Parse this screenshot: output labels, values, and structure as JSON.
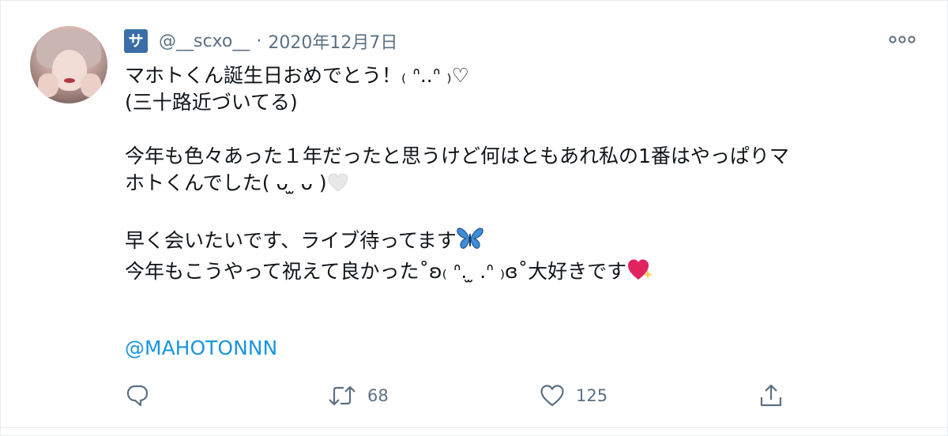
{
  "tweet": {
    "badge_char": "サ",
    "handle": "@__scxo__",
    "separator": "·",
    "date": "2020年12月7日",
    "lines": {
      "l1": "マホトくん誕生日おめでとう！₍ ᐢ..ᐢ ₎♡",
      "l2": "(三十路近づいてる)",
      "l3": "今年も色々あった１年だったと思うけど何はともあれ私の1番はやっぱりマ",
      "l4a": "ホトくんでした( ᴗ ̫ ᴗ )",
      "l5a": "早く会いたいです、ライブ待ってます",
      "l6a": "今年もこうやって祝えて良かった˚ʚ₍ ᐢ. ̫ .ᐢ ₎ɞ˚大好きです"
    },
    "mention": "@MAHOTONNN",
    "emojis": {
      "heart_white": "white-heart-icon",
      "butterfly": "butterfly-icon",
      "sparkling_heart": "sparkling-heart-icon"
    }
  },
  "actions": {
    "reply_icon": "reply-icon",
    "retweet_icon": "retweet-icon",
    "retweet_count": "68",
    "like_icon": "heart-outline-icon",
    "like_count": "125",
    "share_icon": "share-icon",
    "more_icon": "more-horizontal-icon"
  },
  "colors": {
    "text": "#0f1419",
    "secondary": "#5b7083",
    "link": "#1b95e0",
    "badge": "#3b6da8",
    "border": "#e6ecf0"
  }
}
